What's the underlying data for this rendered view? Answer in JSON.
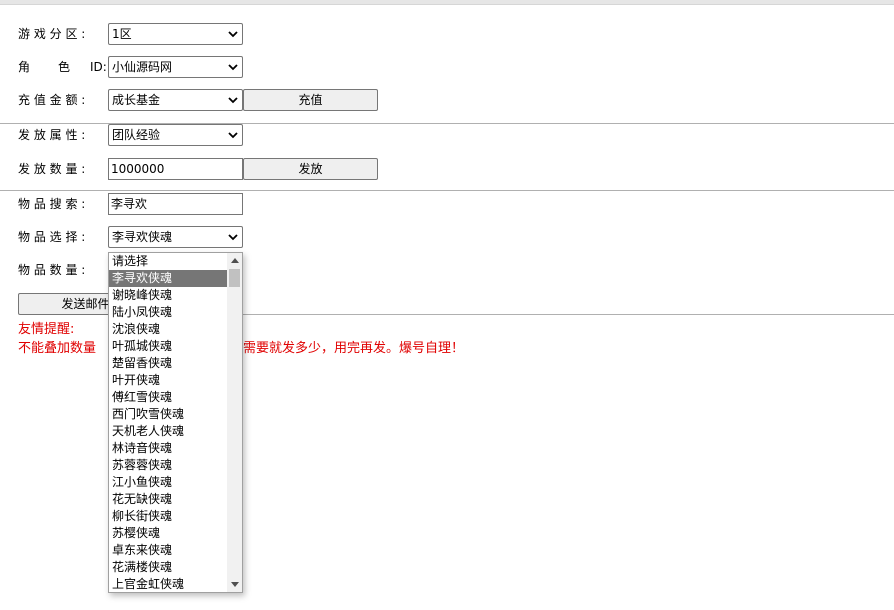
{
  "form": {
    "zone": {
      "label": "游 戏 分 区 :",
      "value": "1区"
    },
    "role": {
      "label": "角      色    ID:",
      "value": "小仙源码网"
    },
    "recharge": {
      "label": "充 值 金 额 :",
      "value": "成长基金",
      "button": "充值"
    },
    "attribute": {
      "label": "发 放 属 性 :",
      "value": "团队经验"
    },
    "quantity": {
      "label": "发 放 数 量 :",
      "value": "1000000",
      "button": "发放"
    },
    "item_search": {
      "label": "物 品 搜 索 :",
      "value": "李寻欢"
    },
    "item_select": {
      "label": "物 品 选 择 :",
      "value": "李寻欢侠魂"
    },
    "item_count": {
      "label": "物 品 数 量 :"
    },
    "send_mail_button": "发送邮件"
  },
  "notice": {
    "title": "友情提醒:",
    "line_left": "不能叠加数量",
    "line_right": "需要就发多少，用完再发。爆号自理！"
  },
  "dropdown": {
    "options": [
      "请选择",
      "李寻欢侠魂",
      "谢晓峰侠魂",
      "陆小凤侠魂",
      "沈浪侠魂",
      "叶孤城侠魂",
      "楚留香侠魂",
      "叶开侠魂",
      "傅红雪侠魂",
      "西门吹雪侠魂",
      "天机老人侠魂",
      "林诗音侠魂",
      "苏蓉蓉侠魂",
      "江小鱼侠魂",
      "花无缺侠魂",
      "柳长街侠魂",
      "苏樱侠魂",
      "卓东来侠魂",
      "花满楼侠魂",
      "上官金虹侠魂"
    ],
    "selected_index": 1
  }
}
